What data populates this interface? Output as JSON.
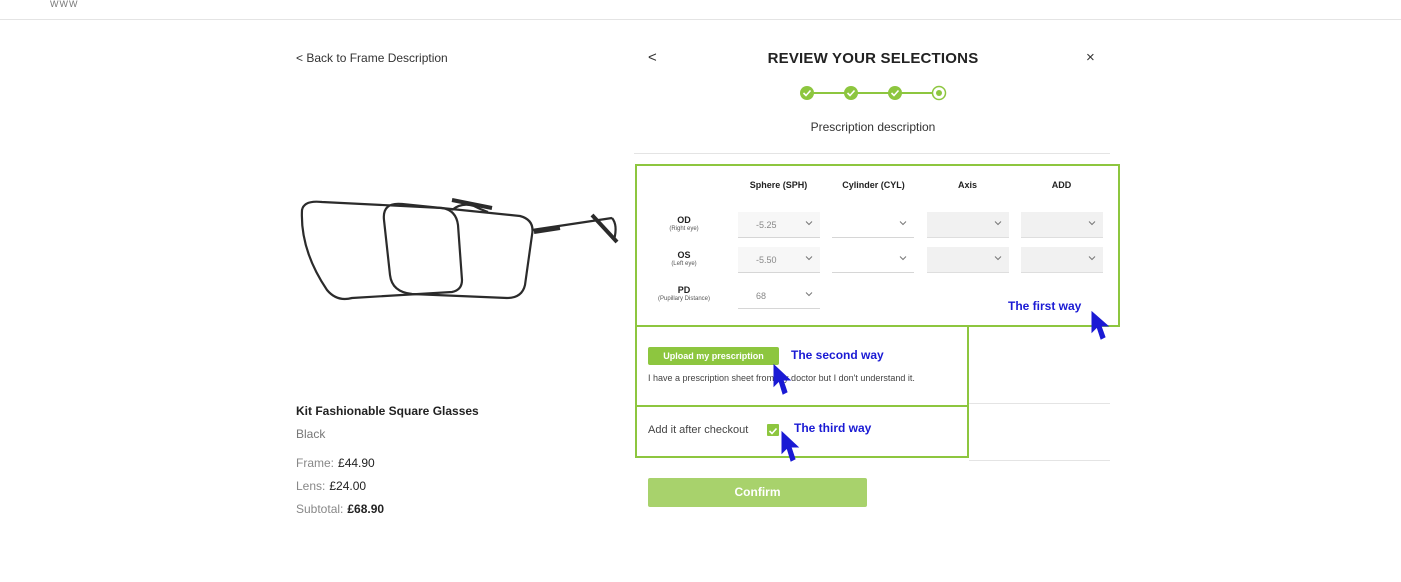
{
  "header": {
    "logo_text": "WWW"
  },
  "left": {
    "back_label": "< Back to Frame Description",
    "product": {
      "name": "Kit Fashionable Square Glasses",
      "color": "Black",
      "frame_label": "Frame:",
      "frame_price": "£44.90",
      "lens_label": "Lens:",
      "lens_price": "£24.00",
      "subtotal_label": "Subtotal:",
      "subtotal_price": "£68.90"
    }
  },
  "panel": {
    "prev_glyph": "<",
    "title": "REVIEW YOUR SELECTIONS",
    "close_glyph": "×",
    "steps_completed": 3,
    "steps_total": 4,
    "step_description": "Prescription description",
    "accent_color": "#8dc63f",
    "prescription": {
      "columns": [
        "Sphere (SPH)",
        "Cylinder (CYL)",
        "Axis",
        "ADD"
      ],
      "rows": [
        {
          "label": "OD",
          "sublabel": "(Right eye)",
          "values": [
            "-5.25",
            "",
            "",
            ""
          ]
        },
        {
          "label": "OS",
          "sublabel": "(Left eye)",
          "values": [
            "-5.50",
            "",
            "",
            ""
          ]
        },
        {
          "label": "PD",
          "sublabel": "(Pupillary Distance)",
          "values": [
            "68"
          ]
        }
      ]
    },
    "upload_button": "Upload my prescription",
    "upload_description": "I have a prescription sheet from my doctor but I don't understand it.",
    "after_checkout_label": "Add it after checkout",
    "after_checkout_checked": true,
    "confirm_button": "Confirm"
  },
  "annotations": {
    "first_way": "The first way",
    "second_way": "The second way",
    "third_way": "The third way",
    "color": "#1a1ad4"
  },
  "icons": {
    "check": "check-icon",
    "chevron": "chevron-down-icon",
    "cursor": "cursor-arrow-icon"
  }
}
